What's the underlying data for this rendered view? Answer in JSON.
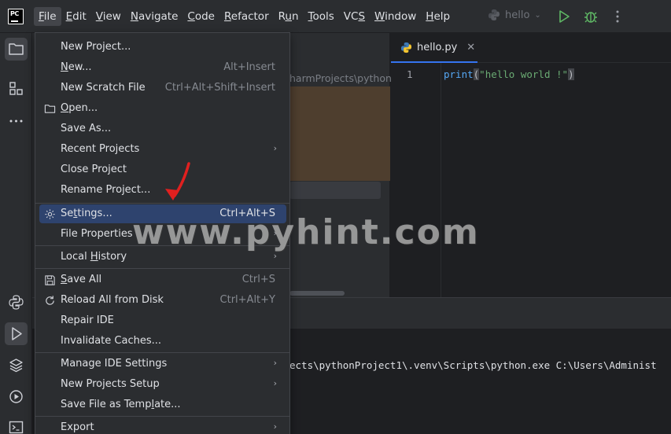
{
  "titlebar": {
    "logo_text": "PC",
    "menu": [
      {
        "pre": "",
        "u": "F",
        "post": "ile",
        "active": true
      },
      {
        "pre": "",
        "u": "E",
        "post": "dit"
      },
      {
        "pre": "",
        "u": "V",
        "post": "iew"
      },
      {
        "pre": "",
        "u": "N",
        "post": "avigate"
      },
      {
        "pre": "",
        "u": "C",
        "post": "ode"
      },
      {
        "pre": "",
        "u": "R",
        "post": "efactor"
      },
      {
        "pre": "R",
        "u": "u",
        "post": "n"
      },
      {
        "pre": "",
        "u": "T",
        "post": "ools"
      },
      {
        "pre": "VC",
        "u": "S",
        "post": ""
      },
      {
        "pre": "",
        "u": "W",
        "post": "indow"
      },
      {
        "pre": "",
        "u": "H",
        "post": "elp"
      }
    ],
    "run_config": "hello"
  },
  "project_panel": {
    "path_fragment": "harmProjects\\python"
  },
  "editor": {
    "tab_name": "hello.py",
    "line_number": "1",
    "code": {
      "fn": "print",
      "open": "(",
      "str": "\"hello world !\"",
      "close": ")"
    }
  },
  "run_panel": {
    "output": "ects\\pythonProject1\\.venv\\Scripts\\python.exe C:\\Users\\Administ"
  },
  "file_menu": {
    "items": [
      {
        "pre": "New Project...",
        "u": "",
        "post": "",
        "shortcut": ""
      },
      {
        "pre": "",
        "u": "N",
        "post": "ew...",
        "shortcut": "Alt+Insert"
      },
      {
        "pre": "New Scratch File",
        "u": "",
        "post": "",
        "shortcut": "Ctrl+Alt+Shift+Insert"
      },
      {
        "pre": "",
        "u": "O",
        "post": "pen...",
        "shortcut": "",
        "icon": "folder-icon"
      },
      {
        "pre": "Save As...",
        "u": "",
        "post": "",
        "shortcut": ""
      },
      {
        "pre": "Recent Projects",
        "u": "",
        "post": "",
        "shortcut": "",
        "submenu": true
      },
      {
        "pre": "Close Project",
        "u": "",
        "post": "",
        "shortcut": ""
      },
      {
        "pre": "Rename Project...",
        "u": "",
        "post": "",
        "shortcut": ""
      },
      {
        "pre": "Se",
        "u": "t",
        "post": "tings...",
        "shortcut": "Ctrl+Alt+S",
        "icon": "gear-icon",
        "selected": true
      },
      {
        "pre": "File Properties",
        "u": "",
        "post": "",
        "shortcut": "",
        "submenu": true
      },
      {
        "pre": "Local ",
        "u": "H",
        "post": "istory",
        "shortcut": "",
        "submenu": true
      },
      {
        "pre": "",
        "u": "S",
        "post": "ave All",
        "shortcut": "Ctrl+S",
        "icon": "save-icon"
      },
      {
        "pre": "Reload All from Disk",
        "u": "",
        "post": "",
        "shortcut": "Ctrl+Alt+Y",
        "icon": "reload-icon"
      },
      {
        "pre": "Repair IDE",
        "u": "",
        "post": "",
        "shortcut": ""
      },
      {
        "pre": "Invalidate Caches...",
        "u": "",
        "post": "",
        "shortcut": ""
      },
      {
        "pre": "Manage IDE Settings",
        "u": "",
        "post": "",
        "shortcut": "",
        "submenu": true
      },
      {
        "pre": "New Projects Setup",
        "u": "",
        "post": "",
        "shortcut": "",
        "submenu": true
      },
      {
        "pre": "Save File as Temp",
        "u": "l",
        "post": "ate...",
        "shortcut": ""
      },
      {
        "pre": "Export",
        "u": "",
        "post": "",
        "shortcut": "",
        "submenu": true
      }
    ],
    "submenu_glyph": "›"
  },
  "watermark": "www.pyhint.com",
  "colors": {
    "accent": "#3574f0",
    "selection": "#2e436e",
    "annotation": "#e0201f"
  }
}
